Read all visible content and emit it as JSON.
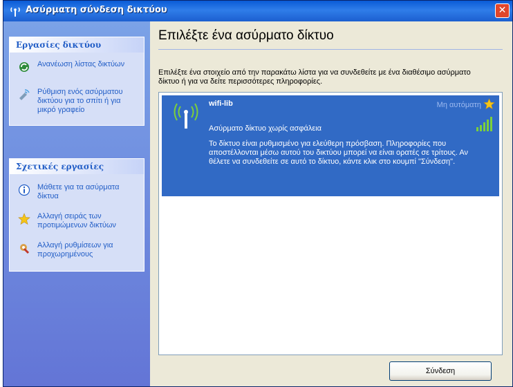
{
  "window": {
    "title": "Ασύρματη σύνδεση δικτύου",
    "close_label": "✕"
  },
  "sidebar": {
    "network_tasks": {
      "title": "Εργασίες δικτύου",
      "items": [
        {
          "label": "Ανανέωση λίστας δικτύων",
          "icon": "refresh-icon"
        },
        {
          "label": "Ρύθμιση ενός ασύρματου δικτύου για το σπίτι ή για μικρό γραφείο",
          "icon": "wireless-setup-icon"
        }
      ]
    },
    "related_tasks": {
      "title": "Σχετικές εργασίες",
      "items": [
        {
          "label": "Μάθετε για τα ασύρματα δίκτυα",
          "icon": "info-icon"
        },
        {
          "label": "Αλλαγή σειράς των προτιμώμενων δικτύων",
          "icon": "star-icon"
        },
        {
          "label": "Αλλαγή ρυθμίσεων για προχωρημένους",
          "icon": "advanced-settings-icon"
        }
      ]
    }
  },
  "main": {
    "heading": "Επιλέξτε ένα ασύρματο δίκτυο",
    "description": "Επιλέξτε ένα στοιχείο από την παρακάτω λίστα για να συνδεθείτε με ένα διαθέσιμο ασύρματο δίκτυο ή για να δείτε περισσότερες πληροφορίες.",
    "networks": [
      {
        "ssid": "wifi-lib",
        "connection_mode": "Μη αυτόματη",
        "security": "Ασύρματο δίκτυο χωρίς ασφάλεια",
        "signal_bars": 5,
        "details": "Το δίκτυο είναι ρυθμισμένο για ελεύθερη πρόσβαση. Πληροφορίες που αποστέλλονται μέσω αυτού του δικτύου μπορεί να είναι ορατές σε τρίτους. Αν θέλετε να συνδεθείτε σε αυτό το δίκτυο, κάντε κλικ στο κουμπί \"Σύνδεση\".",
        "selected": true
      }
    ],
    "connect_label": "Σύνδεση"
  },
  "colors": {
    "title_bar": "#2F7DE9",
    "selection": "#316AC5",
    "sidebar_link": "#215DC6",
    "close_button": "#E0462B",
    "signal": "#7CD03A",
    "star": "#F5C518"
  }
}
